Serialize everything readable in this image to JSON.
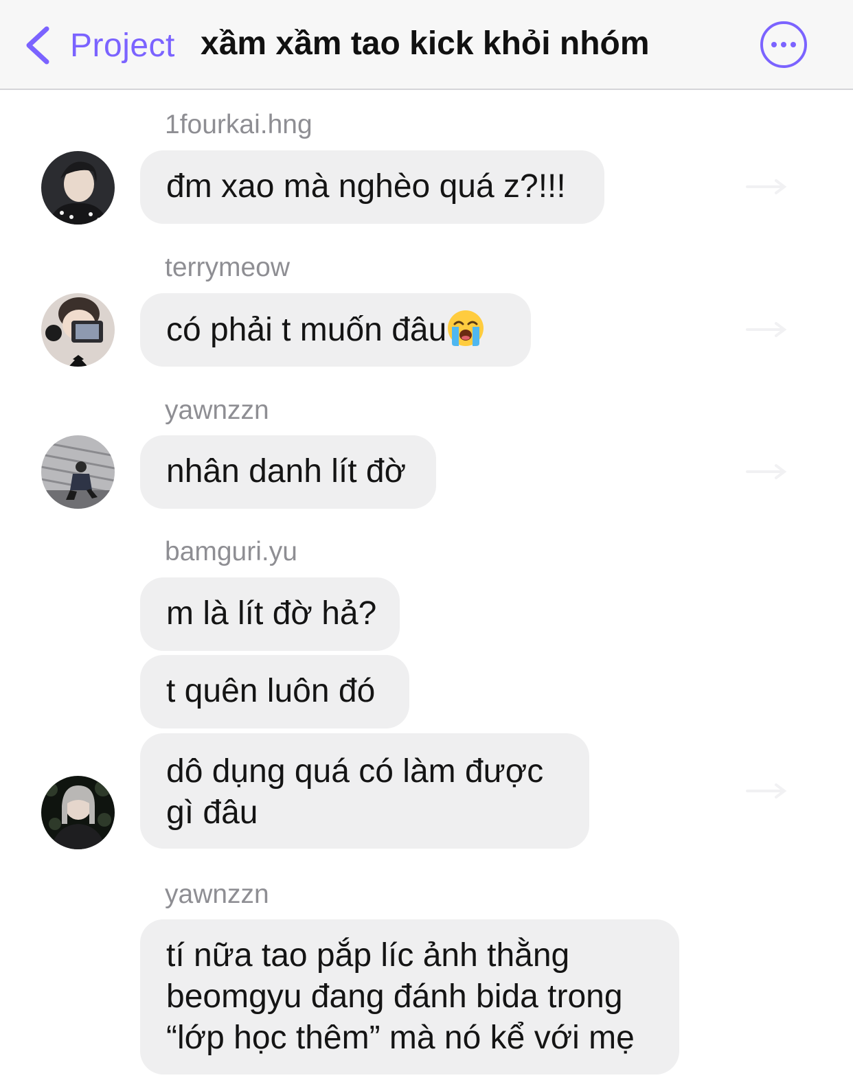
{
  "header": {
    "back_label": "Project",
    "title": "xầm xầm tao kick khỏi nhóm"
  },
  "messages": [
    {
      "sender": "1fourkai.hng",
      "text": "đm xao mà nghèo quá z?!!!"
    },
    {
      "sender": "terrymeow",
      "text": "có phải t muốn đâu",
      "emoji": "loudly-crying-face"
    },
    {
      "sender": "yawnzzn",
      "text": "nhân danh lít đờ"
    },
    {
      "sender": "bamguri.yu",
      "lines": [
        "m là lít đờ hả?",
        "t quên luôn đó",
        "dô dụng quá có làm được",
        "gì đâu"
      ]
    },
    {
      "sender": "yawnzzn",
      "lines": [
        "tí nữa tao pắp líc ảnh thằng",
        "beomgyu đang đánh bida trong",
        "“lớp học thêm” mà nó kể với mẹ"
      ]
    }
  ],
  "colors": {
    "accent": "#7b63ff",
    "bubble": "#efeff0",
    "sender": "#8e8e93"
  },
  "icons": {
    "back": "chevron-left-icon",
    "more": "ellipsis-circle-icon",
    "share": "share-arrow-icon"
  }
}
